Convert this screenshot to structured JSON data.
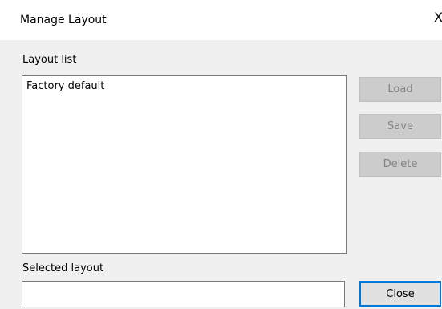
{
  "window": {
    "title": "Manage Layout",
    "close_glyph": "X"
  },
  "layout_list": {
    "label": "Layout list",
    "items": [
      "Factory default"
    ]
  },
  "selected_layout": {
    "label": "Selected layout",
    "value": ""
  },
  "buttons": {
    "load": "Load",
    "save": "Save",
    "delete": "Delete",
    "close": "Close"
  },
  "colors": {
    "accent": "#0078d7",
    "disabled_bg": "#cccccc",
    "disabled_text": "#838383",
    "dialog_bg": "#f0f0f0"
  }
}
